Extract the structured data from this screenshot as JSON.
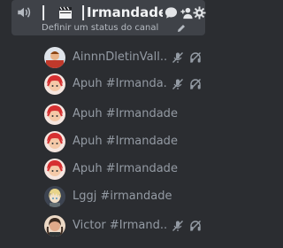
{
  "channel": {
    "separator1": "|",
    "separator2": "|",
    "name": "Irmandade",
    "status_placeholder": "Definir um status do canal"
  },
  "members": [
    {
      "name": "AinnnDletinVall...",
      "muted": true,
      "deafened": true,
      "avatar": "red-shirt-boy"
    },
    {
      "name": "Apuh #Irmanda...",
      "muted": true,
      "deafened": true,
      "avatar": "red-hair-face"
    },
    {
      "name": "Apuh #Irmandade",
      "muted": false,
      "deafened": false,
      "avatar": "red-hair-face"
    },
    {
      "name": "Apuh #Irmandade",
      "muted": false,
      "deafened": false,
      "avatar": "red-hair-face"
    },
    {
      "name": "Apuh #Irmandade",
      "muted": false,
      "deafened": false,
      "avatar": "red-hair-face"
    },
    {
      "name": "Lggj #irmandade",
      "muted": false,
      "deafened": false,
      "avatar": "anime-blonde"
    },
    {
      "name": "Victor #Irmand...",
      "muted": true,
      "deafened": true,
      "avatar": "dark-hair-person"
    }
  ],
  "colors": {
    "background": "#2b2d31",
    "channel_card": "#3f4248",
    "text_primary": "#f2f3f5",
    "text_muted": "#949ba4",
    "icon": "#b5bac1"
  }
}
